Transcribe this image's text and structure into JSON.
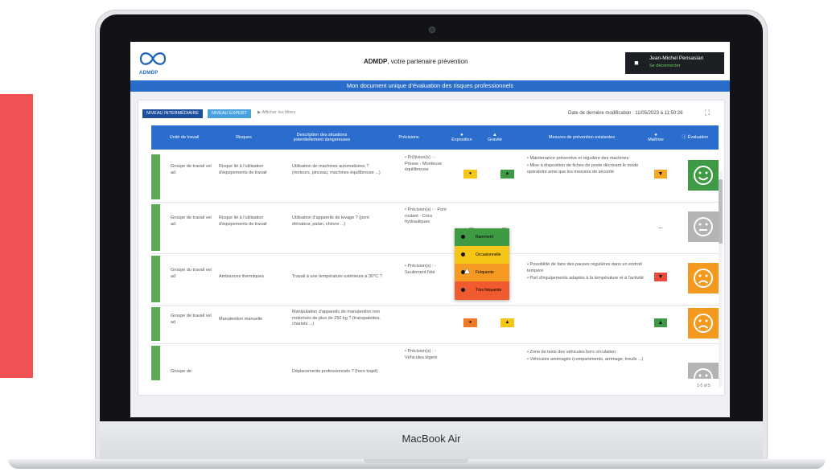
{
  "device": {
    "label": "MacBook Air"
  },
  "header": {
    "logo_text": "ADMDP",
    "tagline_brand": "ADMDP",
    "tagline_rest": ", votre partenaire prévention",
    "user_name": "Jean-Michel Pensasian",
    "user_sub": "Se déconnecter",
    "banner": "Mon document unique d’évaluation des risques professionnels"
  },
  "toolbar": {
    "level_intermediate": "NIVEAU INTERMÉDIAIRE",
    "level_expert": "NIVEAU EXPERT",
    "filters_label": "Afficher les filtres",
    "last_modified": "Date de dernière modification : 11/05/2023 à 11:50:26"
  },
  "table": {
    "columns": {
      "unit": "Unité de travail",
      "risks": "Risques",
      "description": "Description des situations potentiellement dangereuses",
      "precision": "Précisions",
      "exposure": "Exposition",
      "severity": "Gravité",
      "measures": "Mesures de prévention existantes",
      "mastery": "Maîtrise",
      "evaluation": "Évaluation"
    },
    "rows": [
      {
        "unit": "Groupe de travail vel ad",
        "risk": "Risque lié à l'utilisation d'équipements de travail",
        "description": "Utilisation de machines automatisées ? (moteurs, pinceau, machines équilibreuse ...)",
        "precision": "• Pr(t)ision(s) : - Presse - Monteuse équilibreuse",
        "measure_1": "• Maintenance préventive et régulière des machines",
        "measure_2": "• Mise à disposition de fiches de poste décrivant le mode opératoire ainsi que les mesures de sécurité",
        "exposure_color": "#f5c518",
        "severity_color": "#3c9a45",
        "mastery_color": "#f5a623",
        "mastery_icon": "thumbs-down",
        "evaluation_color": "#3f9b43",
        "evaluation_face": "happy"
      },
      {
        "unit": "Groupe de travail vel ad",
        "risk": "Risque lié à l'utilisation d'équipements de travail",
        "description": "Utilisation d'appareils de levage ? (pont élévateur, palan, chèvre ...)",
        "precision": "• Précision(s) : - Pont roulant - Crics hydrauliques",
        "measure_1": "",
        "measure_2": "",
        "exposure_color": "",
        "severity_color": "",
        "mastery_color": "",
        "mastery_icon": "dash",
        "evaluation_color": "#b3b3b3",
        "evaluation_face": "neutral"
      },
      {
        "unit": "Groupe du travail vel ad",
        "risk": "Ambiances thermiques",
        "description": "Travail à une température extérieure à 30°C ?",
        "precision": "• Précision(s) : - Seulement l'été",
        "measure_1": "• Possibilité de faire des pauses régulières dans un endroit tempéré",
        "measure_2": "• Port d'équipements adaptés à la température et à l'activité",
        "exposure_color": "",
        "severity_color": "",
        "mastery_color": "#e8493a",
        "mastery_icon": "thumbs-down",
        "evaluation_color": "#f39a1e",
        "evaluation_face": "sad"
      },
      {
        "unit": "Groupe de travail vel ad",
        "risk": "Manutention manuelle",
        "description": "Manipulation d'appareils de manutention non motorisés de plus de 250 kg ? (transpalettes, chariots ...)",
        "precision": "",
        "measure_1": "",
        "measure_2": "",
        "exposure_color": "#f07a23",
        "severity_color": "#f5c518",
        "mastery_color": "#3c9a45",
        "mastery_icon": "thumbs-up",
        "evaluation_color": "#f39a1e",
        "evaluation_face": "sad"
      },
      {
        "unit": "Groupe de",
        "risk": "",
        "description": "Déplacements professionnels ? (hors trajet)",
        "precision": "• Précision(s) : - Véhicules légers",
        "measure_1": "• Zone de tests des véhicules hors circulation",
        "measure_2": "• Véhicules aménagés (compartiments, arrimage, treuils ...)",
        "exposure_color": "",
        "severity_color": "",
        "mastery_color": "",
        "mastery_icon": "",
        "evaluation_color": "#b3b3b3",
        "evaluation_face": "neutral"
      }
    ]
  },
  "dropdown": {
    "items": [
      {
        "label": "Rarement",
        "color": "#3f9b43"
      },
      {
        "label": "Occasionnelle",
        "color": "#f5c518"
      },
      {
        "label": "Fréquente",
        "color": "#f59a23"
      },
      {
        "label": "Très fréquente",
        "color": "#ef5a2f"
      }
    ]
  },
  "pagination": "1-5 of 5",
  "colors": {
    "primary": "#2b6dcc",
    "accent_red": "#f05152"
  }
}
